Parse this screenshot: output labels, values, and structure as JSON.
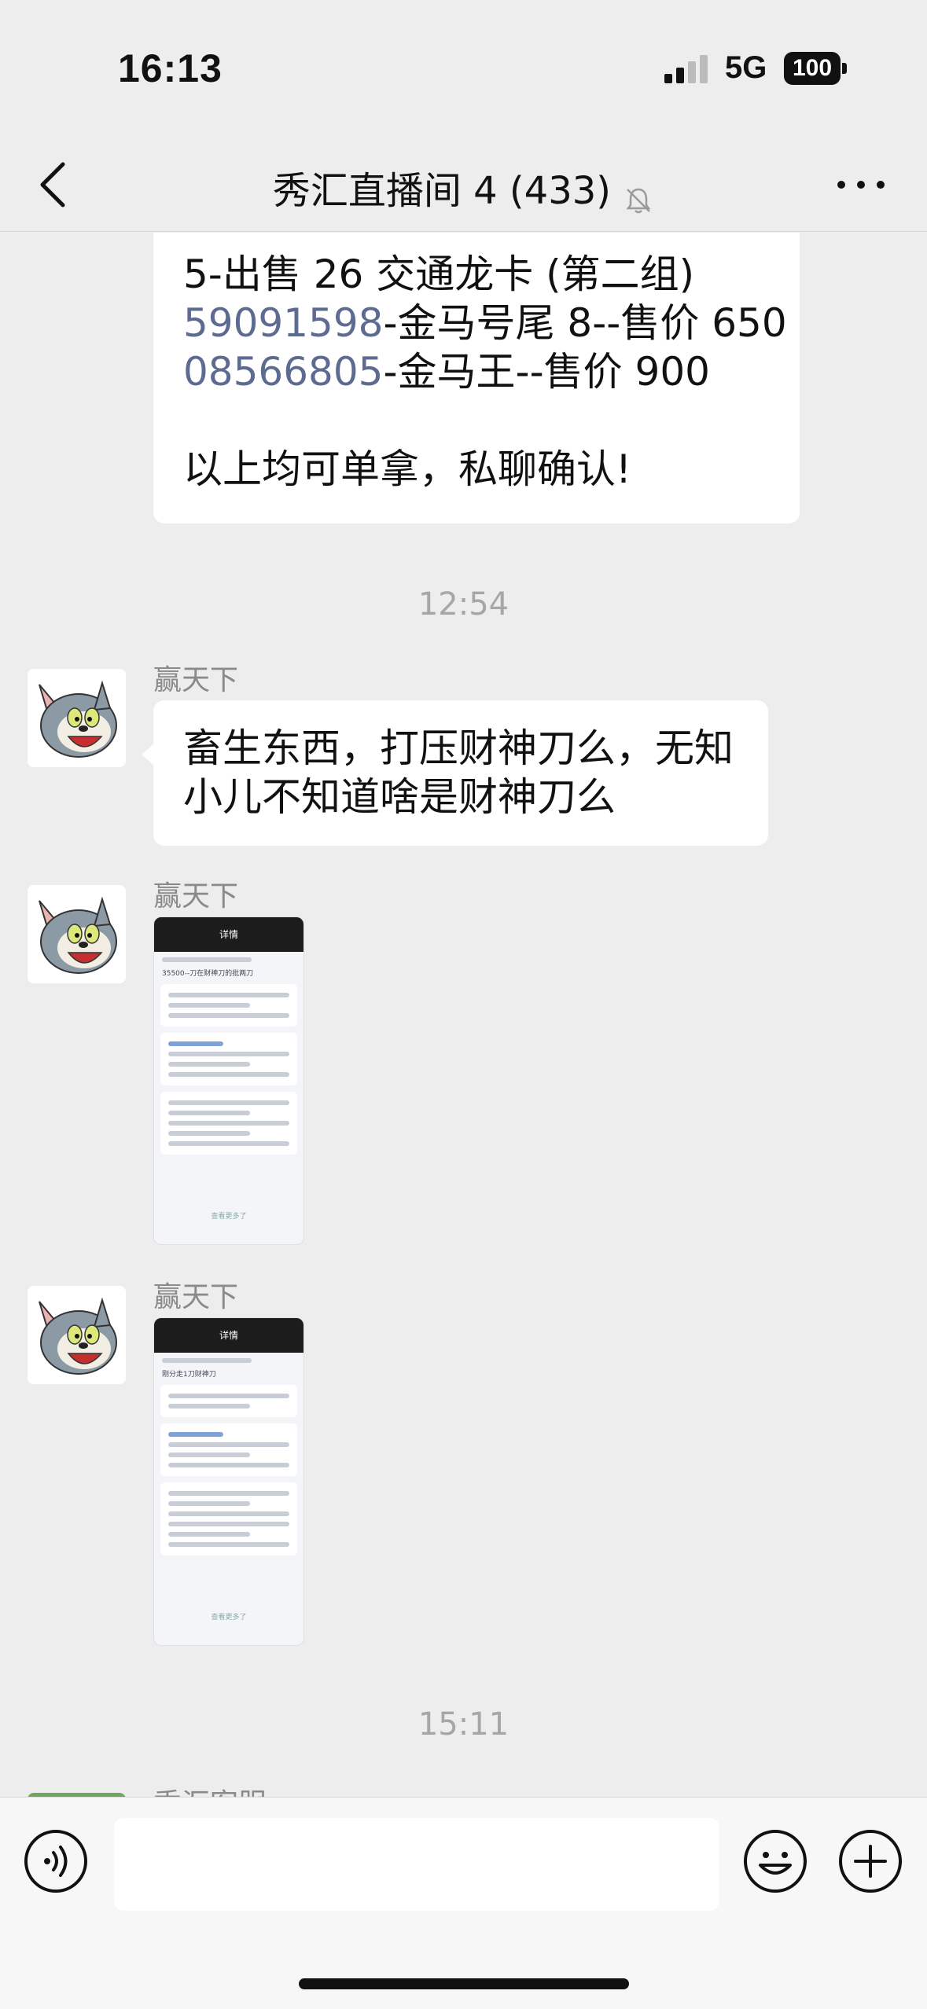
{
  "status_bar": {
    "time": "16:13",
    "network": "5G",
    "battery": "100"
  },
  "header": {
    "title": "秀汇直播间 4 (433)",
    "muted": true
  },
  "messages": {
    "top_bubble": {
      "line1": "5-出售 26 交通龙卡 (第二组)",
      "line2_num": "59091598",
      "line2_rest": "-金马号尾 8--售价 650",
      "line3_num": "08566805",
      "line3_rest": "-金马王--售价 900",
      "line4": "以上均可单拿，私聊确认!"
    },
    "timestamp1": "12:54",
    "msg1": {
      "sender": "赢天下",
      "line1": "畜生东西，打压财神刀么，无知",
      "line2": "小儿不知道啥是财神刀么"
    },
    "msg2": {
      "sender": "赢天下"
    },
    "msg3": {
      "sender": "赢天下"
    },
    "timestamp2": "15:11",
    "msg4": {
      "sender": "秀汇客服"
    }
  },
  "thumb1": {
    "title": "详情",
    "label": "35500--刀在财神刀的批两刀",
    "more": "查看更多了"
  },
  "thumb2": {
    "title": "详情",
    "label": "刚分走1刀财神刀",
    "more": "查看更多了"
  },
  "colors": {
    "background": "#ededed",
    "bubble": "#ffffff",
    "link_number": "#5d6b91",
    "meta_text": "#a6a6a6"
  },
  "icons": [
    "back-arrow-icon",
    "mute-bell-icon",
    "more-dots-icon",
    "voice-icon",
    "emoji-icon",
    "plus-icon"
  ]
}
